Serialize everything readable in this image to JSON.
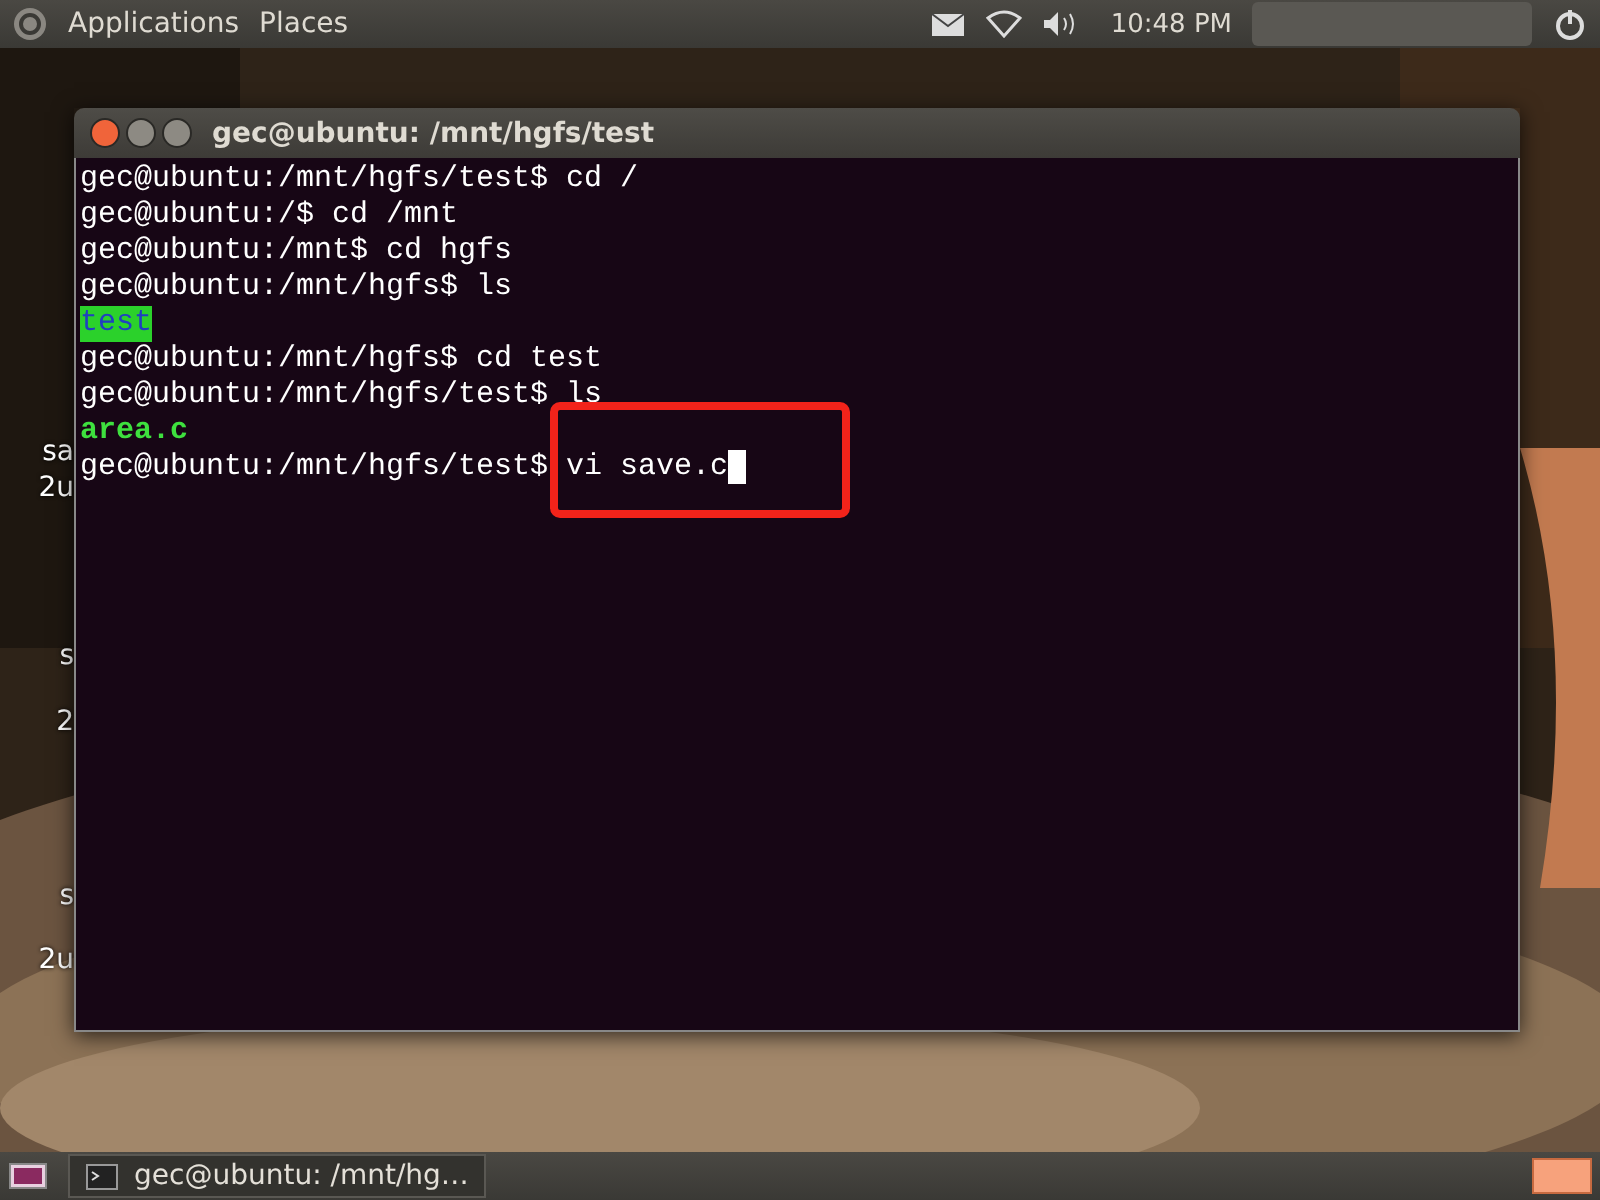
{
  "top_panel": {
    "menus": [
      {
        "label": "Applications"
      },
      {
        "label": "Places"
      }
    ],
    "clock": "10:48 PM"
  },
  "desktop_labels": [
    {
      "label": "sa"
    },
    {
      "label": "2u"
    },
    {
      "label": "s"
    },
    {
      "label": "2"
    },
    {
      "label": "s"
    },
    {
      "label": "2u"
    }
  ],
  "window": {
    "title": "gec@ubuntu: /mnt/hgfs/test"
  },
  "terminal": {
    "lines": [
      {
        "kind": "output",
        "text": "gec@ubuntu:/mnt/hgfs/test$ cd /"
      },
      {
        "kind": "output",
        "text": "gec@ubuntu:/$ cd /mnt"
      },
      {
        "kind": "output",
        "text": "gec@ubuntu:/mnt$ cd hgfs"
      },
      {
        "kind": "output",
        "text": "gec@ubuntu:/mnt/hgfs$ ls"
      },
      {
        "kind": "directory",
        "text": "test"
      },
      {
        "kind": "output",
        "text": "gec@ubuntu:/mnt/hgfs$ cd test"
      },
      {
        "kind": "output",
        "text": "gec@ubuntu:/mnt/hgfs/test$ ls"
      },
      {
        "kind": "file",
        "text": "area.c"
      },
      {
        "kind": "prompt",
        "text": "gec@ubuntu:/mnt/hgfs/test$ vi save.c",
        "highlighted": true
      }
    ]
  },
  "taskbar": {
    "tasks": [
      {
        "label": "gec@ubuntu: /mnt/hg…",
        "selected": false
      }
    ]
  }
}
